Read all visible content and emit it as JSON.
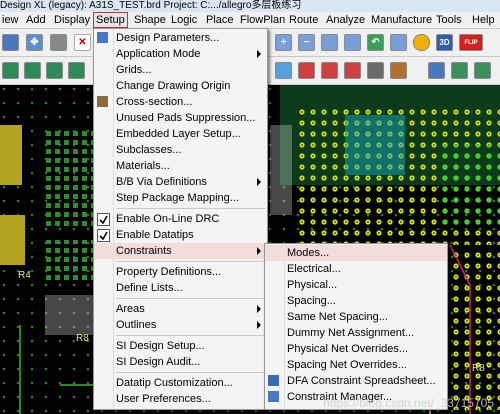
{
  "window": {
    "title": "Design XL (legacy): A31S_TEST.brd  Project: C:.../allegro多层板练习"
  },
  "menubar": [
    "iew",
    "Add",
    "Display",
    "Setup",
    "Shape",
    "Logic",
    "Place",
    "FlowPlan",
    "Route",
    "Analyze",
    "Manufacture",
    "Tools",
    "Help"
  ],
  "toolbar": {
    "label_3d": "3D",
    "label_flip": "FLIP"
  },
  "setup_menu": {
    "items": [
      "Design Parameters...",
      "Application Mode",
      "Grids...",
      "Change Drawing Origin",
      "Cross-section...",
      "Unused Pads Suppression...",
      "Embedded Layer Setup...",
      "Subclasses...",
      "Materials...",
      "B/B Via Definitions",
      "Step Package Mapping...",
      "Enable On-Line DRC",
      "Enable Datatips",
      "Constraints",
      "Property Definitions...",
      "Define Lists...",
      "Areas",
      "Outlines",
      "SI Design Setup...",
      "SI Design Audit...",
      "Datatip Customization...",
      "User Preferences..."
    ]
  },
  "constraints_menu": {
    "items": [
      "Modes...",
      "Electrical...",
      "Physical...",
      "Spacing...",
      "Same Net Spacing...",
      "Dummy Net Assignment...",
      "Physical Net Overrides...",
      "Spacing Net Overrides...",
      "DFA Constraint Spreadsheet...",
      "Constraint Manager..."
    ]
  },
  "canvas": {
    "labels": [
      "R8",
      "R4",
      "R8"
    ]
  },
  "watermark": "https://blog.csdn.net/_33715705"
}
